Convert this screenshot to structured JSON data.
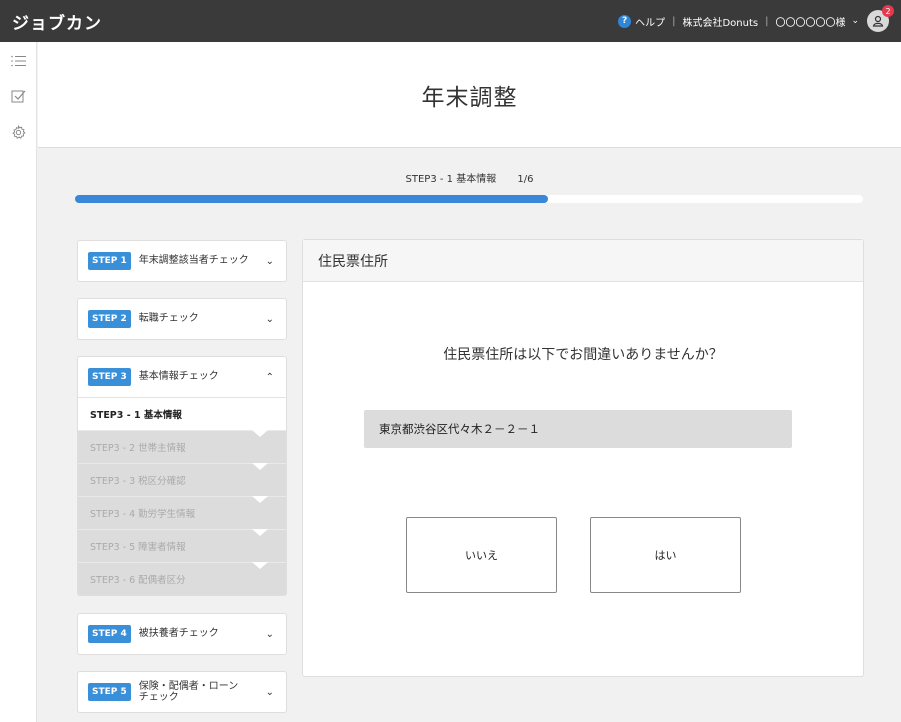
{
  "app": {
    "logo": "ジョブカン"
  },
  "topbar": {
    "help_label": "ヘルプ",
    "company": "株式会社Donuts",
    "user": "〇〇〇〇〇〇様",
    "notification_count": "2"
  },
  "page": {
    "title": "年末調整"
  },
  "progress": {
    "step_label": "STEP3 - 1  基本情報",
    "count": "1/6",
    "fraction": 0.6
  },
  "steps": [
    {
      "tag": "STEP 1",
      "title": "年末調整該当者チェック",
      "chevron": "⌄"
    },
    {
      "tag": "STEP 2",
      "title": "転職チェック",
      "chevron": "⌄"
    },
    {
      "tag": "STEP 3",
      "title": "基本情報チェック",
      "chevron": "⌃",
      "substeps": [
        "STEP3 - 1  基本情報",
        "STEP3 - 2  世帯主情報",
        "STEP3 - 3  税区分確認",
        "STEP3 - 4  勤労学生情報",
        "STEP3 - 5  障害者情報",
        "STEP3 - 6  配偶者区分"
      ]
    },
    {
      "tag": "STEP 4",
      "title": "被扶養者チェック",
      "chevron": "⌄"
    },
    {
      "tag": "STEP 5",
      "title": "保険・配偶者・ローン チェック",
      "chevron": "⌄"
    }
  ],
  "panel": {
    "heading": "住民票住所",
    "question": "住民票住所は以下でお間違いありませんか？",
    "address": "東京都渋谷区代々木２－２－１",
    "no_label": "いいえ",
    "yes_label": "はい"
  },
  "colors": {
    "accent": "#3a86d8",
    "topbar": "#3a3a3a",
    "badge": "#e53950"
  },
  "icons": [
    "menu-icon",
    "checkbox-icon",
    "gear-icon",
    "help-icon",
    "user-icon"
  ]
}
